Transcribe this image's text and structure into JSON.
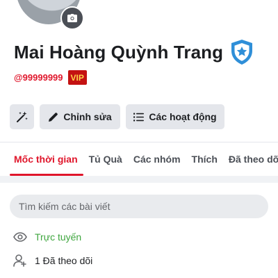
{
  "profile": {
    "name": "Mai Hoàng Quỳnh Trang",
    "username": "@99999999",
    "vip_label": "VIP",
    "icons": {
      "avatar_camera": "camera-icon",
      "verified": "verified-shield-icon"
    }
  },
  "actions": {
    "sparkle_icon": "magic-wand-icon",
    "edit_label": "Chỉnh sửa",
    "edit_icon": "pencil-icon",
    "activity_label": "Các hoạt động",
    "activity_icon": "list-icon"
  },
  "tabs": [
    {
      "label": "Mốc thời gian",
      "active": true
    },
    {
      "label": "Tủ Quà",
      "active": false
    },
    {
      "label": "Các nhóm",
      "active": false
    },
    {
      "label": "Thích",
      "active": false
    },
    {
      "label": "Đã theo dõi",
      "active": false
    }
  ],
  "search": {
    "placeholder": "Tìm kiếm các bài viết"
  },
  "info": {
    "online_label": "Trực tuyến",
    "following_label": "1 Đã theo dõi"
  },
  "colors": {
    "accent": "#e0162b",
    "online": "#3fa63f",
    "vip_bg": "#c41212",
    "vip_text": "#ffd24a",
    "button_bg": "#e4e6eb",
    "badge_blue": "#2f8fd8"
  }
}
